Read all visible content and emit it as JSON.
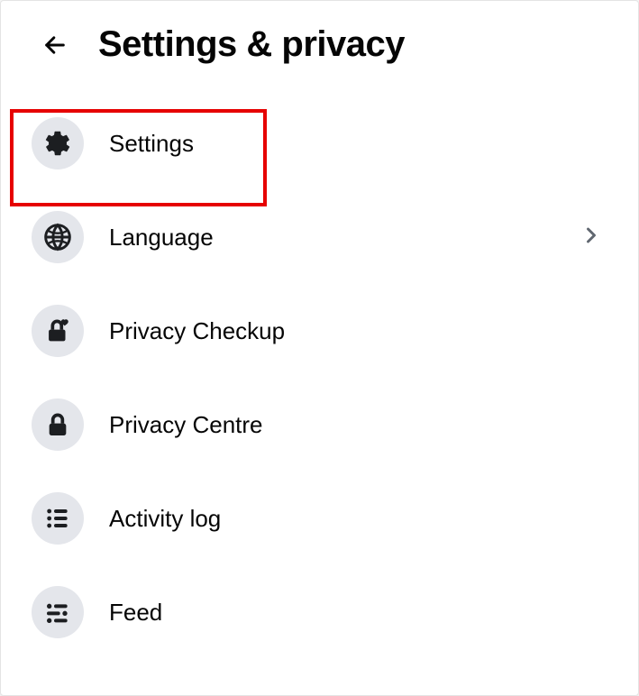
{
  "header": {
    "title": "Settings & privacy"
  },
  "menu": {
    "items": [
      {
        "label": "Settings",
        "icon": "gear-icon",
        "has_chevron": false
      },
      {
        "label": "Language",
        "icon": "globe-icon",
        "has_chevron": true
      },
      {
        "label": "Privacy Checkup",
        "icon": "lock-heart-icon",
        "has_chevron": false
      },
      {
        "label": "Privacy Centre",
        "icon": "lock-icon",
        "has_chevron": false
      },
      {
        "label": "Activity log",
        "icon": "list-icon",
        "has_chevron": false
      },
      {
        "label": "Feed",
        "icon": "feed-icon",
        "has_chevron": false
      }
    ]
  },
  "highlight": {
    "target": "menu-item-settings"
  }
}
